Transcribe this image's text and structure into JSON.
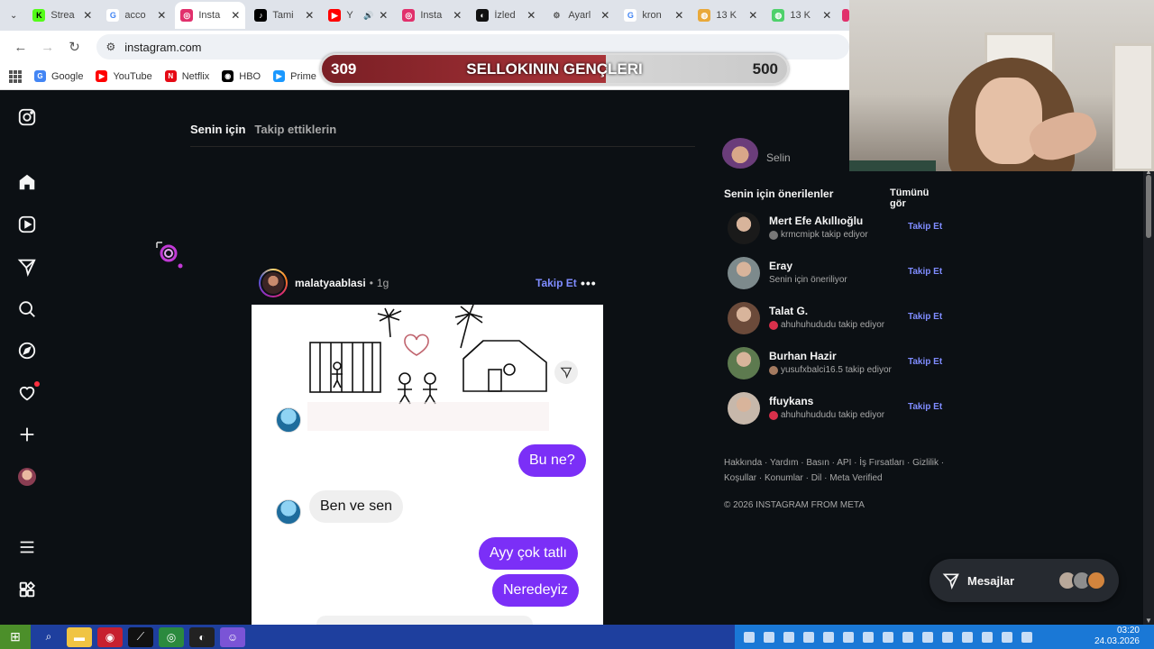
{
  "browser": {
    "tabs": [
      {
        "title": "Strea",
        "fav_color": "#53fc18",
        "fav_glyph": "K",
        "fav_text": "#000"
      },
      {
        "title": "acco",
        "fav_color": "#ffffff",
        "fav_glyph": "G",
        "fav_text": "#4285f4"
      },
      {
        "title": "Insta",
        "fav_color": "#e1306c",
        "fav_glyph": "◎",
        "fav_text": "#fff",
        "active": true
      },
      {
        "title": "Tami",
        "fav_color": "#000000",
        "fav_glyph": "♪",
        "fav_text": "#fff"
      },
      {
        "title": "Y",
        "fav_color": "#ff0000",
        "fav_glyph": "▶",
        "fav_text": "#fff",
        "audio": true
      },
      {
        "title": "Insta",
        "fav_color": "#e1306c",
        "fav_glyph": "◎",
        "fav_text": "#fff"
      },
      {
        "title": "İzled",
        "fav_color": "#111111",
        "fav_glyph": "◐",
        "fav_text": "#fff"
      },
      {
        "title": "Ayarl",
        "fav_color": "#dfe3ea",
        "fav_glyph": "⚙",
        "fav_text": "#555"
      },
      {
        "title": "kron",
        "fav_color": "#ffffff",
        "fav_glyph": "G",
        "fav_text": "#4285f4"
      },
      {
        "title": "13 K",
        "fav_color": "#e9a93a",
        "fav_glyph": "◍",
        "fav_text": "#fff"
      },
      {
        "title": "13 K",
        "fav_color": "#4fd16b",
        "fav_glyph": "◍",
        "fav_text": "#fff"
      }
    ],
    "url": "instagram.com",
    "bookmarks": [
      {
        "label": "Google",
        "color": "#4285f4",
        "glyph": "G"
      },
      {
        "label": "YouTube",
        "color": "#ff0000",
        "glyph": "▶"
      },
      {
        "label": "Netflix",
        "color": "#e50914",
        "glyph": "N"
      },
      {
        "label": "HBO",
        "color": "#000000",
        "glyph": "◉"
      },
      {
        "label": "Prime",
        "color": "#1a98ff",
        "glyph": "▶"
      }
    ]
  },
  "overlay": {
    "left": "309",
    "title": "SELLOKININ GENÇLERI",
    "right": "500",
    "progress": 0.61
  },
  "feed": {
    "tab_active": "Senin için",
    "tab_other": "Takip ettiklerin",
    "post": {
      "username": "malatyaablasi",
      "dot": "•",
      "time": "1g",
      "follow": "Takip Et",
      "more": "•••",
      "messages": [
        {
          "from": "me",
          "text": "Bu ne?"
        },
        {
          "from": "them",
          "text": "Ben ve sen"
        },
        {
          "from": "me",
          "text": "Ayy çok tatlı"
        },
        {
          "from": "me",
          "text": "Neredeyiz"
        }
      ]
    }
  },
  "sidebar_right": {
    "current_user": "Selin",
    "suggestions_title": "Senin için önerilenler",
    "see_all": "Tümünü gör",
    "suggestions": [
      {
        "name": "Mert Efe Akıllıoğlu",
        "sub": "krmcmipk takip ediyor",
        "follow": "Takip Et",
        "avatar_color": "#1a1a1a",
        "mini_color": "#777"
      },
      {
        "name": "Eray",
        "sub": "Senin için öneriliyor",
        "follow": "Takip Et",
        "avatar_color": "#7d8a8c",
        "mini_color": ""
      },
      {
        "name": "Talat G.",
        "sub": "ahuhuhududu takip ediyor",
        "follow": "Takip Et",
        "avatar_color": "#6b4a3a",
        "mini_color": "#d9304b"
      },
      {
        "name": "Burhan Hazir",
        "sub": "yusufxbalci16.5 takip ediyor",
        "follow": "Takip Et",
        "avatar_color": "#5d7a4f",
        "mini_color": "#a47a60"
      },
      {
        "name": "ffuykans",
        "sub": "ahuhuhududu takip ediyor",
        "follow": "Takip Et",
        "avatar_color": "#c7b8ab",
        "mini_color": "#d9304b"
      }
    ],
    "footer_line1": "Hakkında · Yardım · Basın · API · İş Fırsatları · Gizlilik ·",
    "footer_line2": "Koşullar · Konumlar · Dil · Meta Verified",
    "copyright": "© 2026 INSTAGRAM FROM META"
  },
  "messages_widget": {
    "label": "Mesajlar"
  },
  "taskbar": {
    "time": "03:20",
    "date": "24.03.2026"
  },
  "colors": {
    "ig_bg": "#0c1014",
    "link_blue": "#7f8cff",
    "bubble_purple": "#7b2ff7",
    "taskbar": "#1e3f9e"
  }
}
